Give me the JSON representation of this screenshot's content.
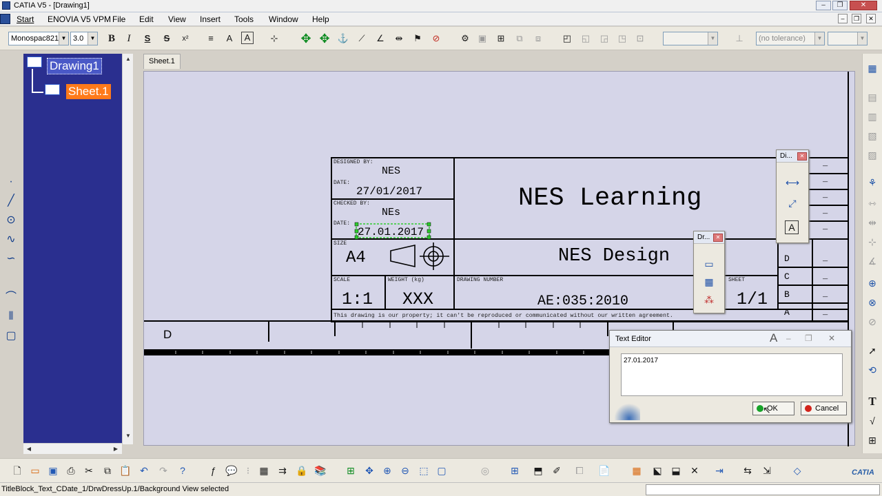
{
  "window": {
    "title": "CATIA V5 - [Drawing1]",
    "minimize": "–",
    "restore": "❐",
    "close": "✕"
  },
  "menu": {
    "start": "Start",
    "enovia": "ENOVIA V5 VPM",
    "file": "File",
    "edit": "Edit",
    "view": "View",
    "insert": "Insert",
    "tools": "Tools",
    "window": "Window",
    "help": "Help"
  },
  "toolbar": {
    "font_name": "Monospac821",
    "font_size": "3.0",
    "bold": "B",
    "italic": "I",
    "underline": "S",
    "strikethrough": "S",
    "superscript": "x²",
    "tolerance": "(no tolerance)"
  },
  "tree": {
    "root": "Drawing1",
    "child": "Sheet.1"
  },
  "sheet_tab": "Sheet.1",
  "title_block": {
    "designed_by_label": "DESIGNED BY:",
    "designed_by": "NES",
    "date_label": "DATE:",
    "date": "27/01/2017",
    "checked_by_label": "CHECKED BY:",
    "checked_by": "NEs",
    "date2_label": "DATE:",
    "date2": "27.01.2017",
    "company": "NES Learning",
    "size_label": "SIZE",
    "size": "A4",
    "title": "NES Design",
    "scale_label": "SCALE",
    "scale": "1:1",
    "weight_label": "WEIGHT (kg)",
    "weight": "XXX",
    "drawing_number_label": "DRAWING NUMBER",
    "drawing_number": "AE:035:2010",
    "sheet_label": "SHEET",
    "sheet": "1/1",
    "property_notice": "This drawing is our property; it can't be reproduced or communicated without our written agreement.",
    "rev_letters": [
      "D",
      "C",
      "B",
      "A"
    ],
    "rev_dash": "_",
    "zone_letter": "D"
  },
  "float_toolbars": {
    "dimensioning": "Di...",
    "drawing": "Dr..."
  },
  "text_editor": {
    "title": "Text Editor",
    "font_glyph": "A",
    "content": "27.01.2017",
    "ok": "OK",
    "cancel": "Cancel"
  },
  "status": {
    "message": "TitleBlock_Text_CDate_1/DrwDressUp.1/Background View selected"
  },
  "branding": {
    "logo_text": "CATIA"
  },
  "colors": {
    "tree_background": "#2a2f8f",
    "tree_selected": "#ff7a1a",
    "canvas": "#d5d5e8",
    "selection_green": "#2ecc2e"
  }
}
